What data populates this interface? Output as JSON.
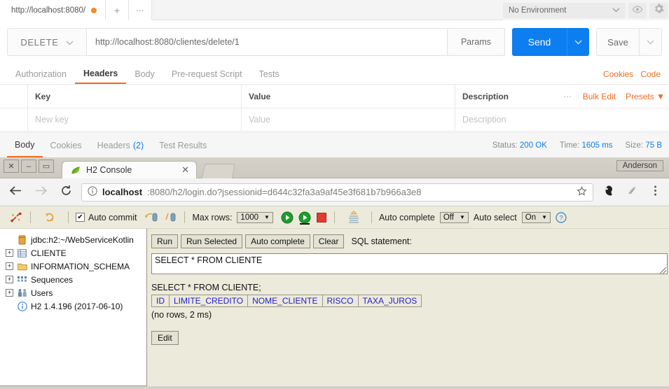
{
  "postman": {
    "tabs": [
      {
        "label": "http://localhost:8080/",
        "dirty_icon": "unsaved-dot"
      }
    ],
    "new_tab_icon": "plus-icon",
    "more_tab_icon": "ellipsis-icon",
    "environment": {
      "selected": "No Environment",
      "caret_icon": "chevron-down-icon",
      "eye_icon": "eye-icon",
      "gear_icon": "gear-icon"
    },
    "request": {
      "method": "DELETE",
      "method_caret_icon": "chevron-down-icon",
      "url": "http://localhost:8080/clientes/delete/1",
      "params_label": "Params",
      "send_label": "Send",
      "send_caret_icon": "chevron-down-icon",
      "save_label": "Save",
      "save_caret_icon": "chevron-down-icon"
    },
    "request_tabs": [
      {
        "label": "Authorization",
        "active": false
      },
      {
        "label": "Headers",
        "active": true
      },
      {
        "label": "Body",
        "active": false
      },
      {
        "label": "Pre-request Script",
        "active": false
      },
      {
        "label": "Tests",
        "active": false
      }
    ],
    "request_links": [
      {
        "label": "Cookies"
      },
      {
        "label": "Code"
      }
    ],
    "headers_table": {
      "columns": [
        "Key",
        "Value",
        "Description"
      ],
      "tools": {
        "more_icon": "ellipsis-icon",
        "bulk_edit": "Bulk Edit",
        "presets": "Presets",
        "presets_caret_icon": "caret-down-icon"
      },
      "new_row": {
        "key_placeholder": "New key",
        "value_placeholder": "Value",
        "description_placeholder": "Description"
      }
    },
    "response": {
      "tabs": [
        {
          "label": "Body",
          "count": "",
          "active": true
        },
        {
          "label": "Cookies",
          "count": "",
          "active": false
        },
        {
          "label": "Headers",
          "count": "(2)",
          "active": false
        },
        {
          "label": "Test Results",
          "count": "",
          "active": false
        }
      ],
      "status_label": "Status:",
      "status_value": "200 OK",
      "time_label": "Time:",
      "time_value": "1605 ms",
      "size_label": "Size:",
      "size_value": "75 B"
    },
    "colors": {
      "accent": "#f26b21",
      "send_blue": "#0d7ef0",
      "link_blue": "#0d7ef0"
    }
  },
  "browser": {
    "window_buttons": {
      "close": "✕",
      "minimize": "–",
      "maximize": "▭"
    },
    "user_label": "Anderson",
    "tab": {
      "title": "H2 Console",
      "favicon": "h2-leaf-icon",
      "close_icon": "close-icon"
    },
    "new_tab_icon": "new-tab-icon",
    "nav": {
      "back_icon": "arrow-left-icon",
      "forward_icon": "arrow-right-icon",
      "reload_icon": "reload-icon",
      "info_icon": "info-circle-icon",
      "bookmark_icon": "star-icon",
      "extension_icon": "extension-icon",
      "extension2_icon": "extension-icon",
      "menu_icon": "kebab-menu-icon"
    },
    "omnibox": {
      "host": "localhost",
      "path": ":8080/h2/login.do?jsessionid=d644c32fa3a9af45e3f681b7b966a3e8"
    }
  },
  "h2": {
    "toolbar": {
      "disconnect_icon": "disconnect-icon",
      "refresh_icon": "refresh-icon",
      "auto_commit_label": "Auto commit",
      "auto_commit_checked": "✔",
      "commit_icon": "commit-icon",
      "rollback_icon": "rollback-icon",
      "max_rows_label": "Max rows:",
      "max_rows_value": "1000",
      "run_icon": "run-green-icon",
      "run_selected_icon": "run-selected-green-icon",
      "stop_icon": "stop-red-icon",
      "autocomplete_panel_icon": "autocomplete-panel-icon",
      "auto_complete_label": "Auto complete",
      "auto_complete_value": "Off",
      "auto_select_label": "Auto select",
      "auto_select_value": "On",
      "help_icon": "help-circle-icon"
    },
    "tree": [
      {
        "label": "jdbc:h2:~/WebServiceKotlin",
        "icon": "database-icon",
        "expander": ""
      },
      {
        "label": "CLIENTE",
        "icon": "table-icon",
        "expander": "+"
      },
      {
        "label": "INFORMATION_SCHEMA",
        "icon": "folder-icon",
        "expander": "+"
      },
      {
        "label": "Sequences",
        "icon": "sequence-icon",
        "expander": "+"
      },
      {
        "label": "Users",
        "icon": "users-icon",
        "expander": "+"
      },
      {
        "label": "H2 1.4.196 (2017-06-10)",
        "icon": "info-circle-icon",
        "expander": ""
      }
    ],
    "buttons": {
      "run": "Run",
      "run_selected": "Run Selected",
      "auto_complete": "Auto complete",
      "clear": "Clear",
      "sql_statement_label": "SQL statement:",
      "edit": "Edit"
    },
    "sql_input": "SELECT * FROM CLIENTE",
    "result": {
      "echo": "SELECT * FROM CLIENTE;",
      "columns": [
        "ID",
        "LIMITE_CREDITO",
        "NOME_CLIENTE",
        "RISCO",
        "TAXA_JUROS"
      ],
      "rows": [],
      "row_status": "(no rows, 2 ms)"
    }
  }
}
